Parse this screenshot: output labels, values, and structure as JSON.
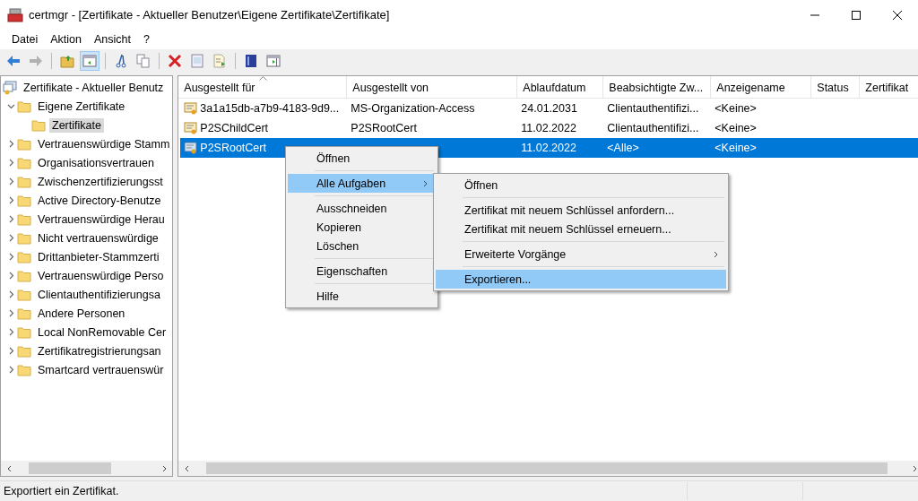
{
  "window": {
    "title": "certmgr - [Zertifikate - Aktueller Benutzer\\Eigene Zertifikate\\Zertifikate]"
  },
  "menu_bar": [
    "Datei",
    "Aktion",
    "Ansicht",
    "?"
  ],
  "toolbar": [
    {
      "kind": "back",
      "disabled": false,
      "pressed": false
    },
    {
      "kind": "forward",
      "disabled": true,
      "pressed": false
    },
    {
      "kind": "sep"
    },
    {
      "kind": "up",
      "disabled": false,
      "pressed": false
    },
    {
      "kind": "tree",
      "disabled": false,
      "pressed": true
    },
    {
      "kind": "sep"
    },
    {
      "kind": "cut",
      "disabled": false,
      "pressed": false
    },
    {
      "kind": "copy",
      "disabled": false,
      "pressed": false
    },
    {
      "kind": "sep"
    },
    {
      "kind": "delete",
      "disabled": false,
      "pressed": false
    },
    {
      "kind": "properties",
      "disabled": false,
      "pressed": false
    },
    {
      "kind": "export",
      "disabled": false,
      "pressed": false
    },
    {
      "kind": "sep"
    },
    {
      "kind": "help",
      "disabled": false,
      "pressed": false
    },
    {
      "kind": "pane",
      "disabled": false,
      "pressed": false
    }
  ],
  "tree": [
    {
      "label": "Zertifikate - Aktueller Benutz",
      "kind": "store",
      "selected": false,
      "children": [
        {
          "label": "Eigene Zertifikate",
          "kind": "folder",
          "expanded": true,
          "selected": false,
          "children": [
            {
              "label": "Zertifikate",
              "kind": "folder",
              "selected": true
            }
          ]
        },
        {
          "label": "Vertrauenswürdige Stamm",
          "kind": "folder",
          "expanded": false,
          "selected": false
        },
        {
          "label": "Organisationsvertrauen",
          "kind": "folder",
          "expanded": false,
          "selected": false
        },
        {
          "label": "Zwischenzertifizierungsst",
          "kind": "folder",
          "expanded": false,
          "selected": false
        },
        {
          "label": "Active Directory-Benutze",
          "kind": "folder",
          "expanded": false,
          "selected": false
        },
        {
          "label": "Vertrauenswürdige Herau",
          "kind": "folder",
          "expanded": false,
          "selected": false
        },
        {
          "label": "Nicht vertrauenswürdige",
          "kind": "folder",
          "expanded": false,
          "selected": false
        },
        {
          "label": "Drittanbieter-Stammzerti",
          "kind": "folder",
          "expanded": false,
          "selected": false
        },
        {
          "label": "Vertrauenswürdige Perso",
          "kind": "folder",
          "expanded": false,
          "selected": false
        },
        {
          "label": "Clientauthentifizierungsa",
          "kind": "folder",
          "expanded": false,
          "selected": false
        },
        {
          "label": "Andere Personen",
          "kind": "folder",
          "expanded": false,
          "selected": false
        },
        {
          "label": "Local NonRemovable Cer",
          "kind": "folder",
          "expanded": false,
          "selected": false
        },
        {
          "label": "Zertifikatregistrierungsan",
          "kind": "folder",
          "expanded": false,
          "selected": false
        },
        {
          "label": "Smartcard vertrauenswür",
          "kind": "folder",
          "expanded": false,
          "selected": false
        }
      ]
    }
  ],
  "table": {
    "columns": [
      {
        "label": "Ausgestellt für",
        "sorted": true
      },
      {
        "label": "Ausgestellt von",
        "sorted": false
      },
      {
        "label": "Ablaufdatum",
        "sorted": false
      },
      {
        "label": "Beabsichtigte Zw...",
        "sorted": false
      },
      {
        "label": "Anzeigename",
        "sorted": false
      },
      {
        "label": "Status",
        "sorted": false
      },
      {
        "label": "Zertifikat",
        "sorted": false
      }
    ],
    "rows": [
      {
        "cells": [
          "3a1a15db-a7b9-4183-9d9...",
          "MS-Organization-Access",
          "24.01.2031",
          "Clientauthentifizi...",
          "<Keine>"
        ],
        "kind": "cert",
        "selected": false
      },
      {
        "cells": [
          "P2SChildCert",
          "P2SRootCert",
          "11.02.2022",
          "Clientauthentifizi...",
          "<Keine>"
        ],
        "kind": "cert",
        "selected": false
      },
      {
        "cells": [
          "P2SRootCert",
          null,
          "11.02.2022",
          "<Alle>",
          "<Keine>"
        ],
        "kind": "root-cert",
        "selected": true
      }
    ]
  },
  "context_menu": [
    {
      "kind": "item",
      "label": "Öffnen",
      "selected": false,
      "submenu": false
    },
    {
      "kind": "sep"
    },
    {
      "kind": "item",
      "label": "Alle Aufgaben",
      "selected": true,
      "submenu": true
    },
    {
      "kind": "sep"
    },
    {
      "kind": "item",
      "label": "Ausschneiden",
      "selected": false,
      "submenu": false
    },
    {
      "kind": "item",
      "label": "Kopieren",
      "selected": false,
      "submenu": false
    },
    {
      "kind": "item",
      "label": "Löschen",
      "selected": false,
      "submenu": false
    },
    {
      "kind": "sep"
    },
    {
      "kind": "item",
      "label": "Eigenschaften",
      "selected": false,
      "submenu": false
    },
    {
      "kind": "sep"
    },
    {
      "kind": "item",
      "label": "Hilfe",
      "selected": false,
      "submenu": false
    }
  ],
  "submenu": [
    {
      "kind": "item",
      "label": "Öffnen",
      "selected": false,
      "submenu": false
    },
    {
      "kind": "sep"
    },
    {
      "kind": "item",
      "label": "Zertifikat mit neuem Schlüssel anfordern...",
      "selected": false,
      "submenu": false
    },
    {
      "kind": "item",
      "label": "Zertifikat mit neuem Schlüssel erneuern...",
      "selected": false,
      "submenu": false
    },
    {
      "kind": "sep"
    },
    {
      "kind": "item",
      "label": "Erweiterte Vorgänge",
      "selected": false,
      "submenu": true
    },
    {
      "kind": "sep"
    },
    {
      "kind": "item",
      "label": "Exportieren...",
      "selected": true,
      "submenu": false
    }
  ],
  "status_bar": {
    "text": "Exportiert ein Zertifikat."
  }
}
